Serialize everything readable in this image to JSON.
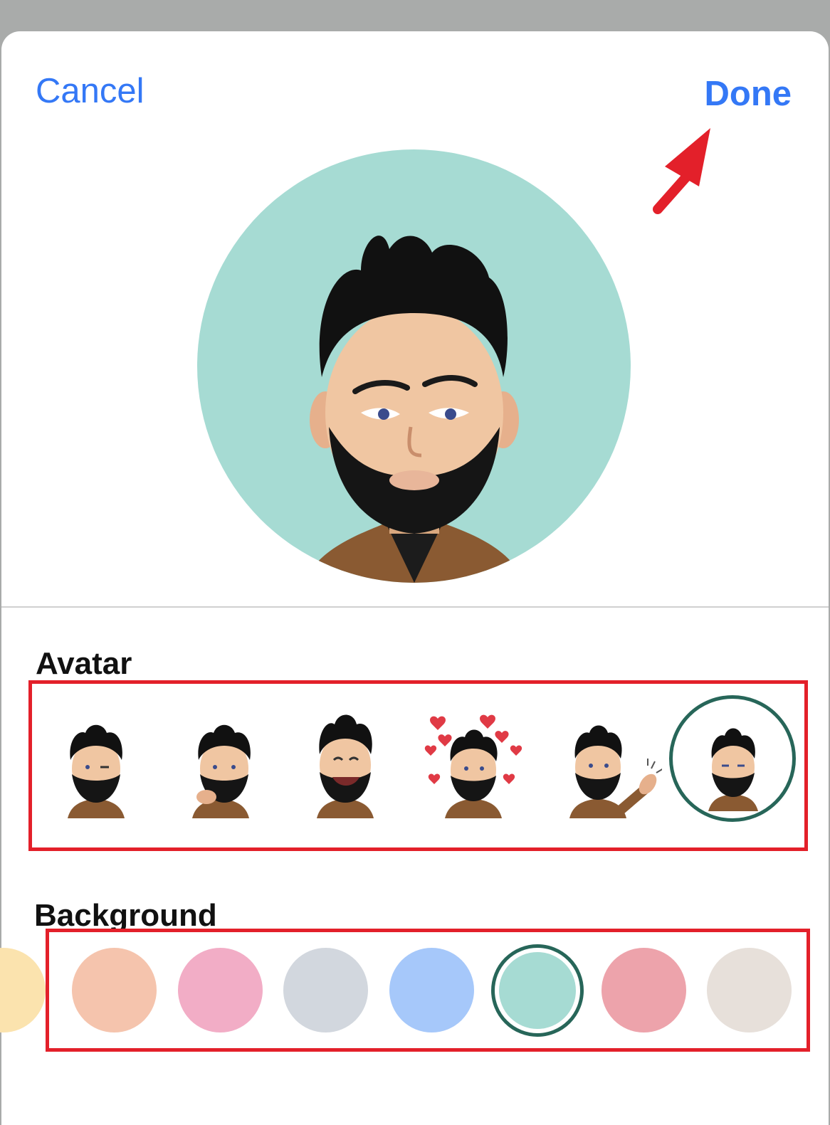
{
  "header": {
    "cancel_label": "Cancel",
    "done_label": "Done"
  },
  "preview": {
    "background_color": "#a6dbd3",
    "avatar_icon": "memoji-avatar-icon"
  },
  "sections": {
    "avatar_title": "Avatar",
    "background_title": "Background"
  },
  "avatars": [
    {
      "name": "memoji-wink-icon",
      "selected": false
    },
    {
      "name": "memoji-thinking-icon",
      "selected": false
    },
    {
      "name": "memoji-laughing-icon",
      "selected": false
    },
    {
      "name": "memoji-hearts-icon",
      "selected": false
    },
    {
      "name": "memoji-clapping-icon",
      "selected": false
    },
    {
      "name": "memoji-neutral-icon",
      "selected": true
    }
  ],
  "backgrounds": [
    {
      "color": "#fbe3ae",
      "selected": false
    },
    {
      "color": "#f5c4ad",
      "selected": false
    },
    {
      "color": "#f2adc6",
      "selected": false
    },
    {
      "color": "#d2d7de",
      "selected": false
    },
    {
      "color": "#a6c8fa",
      "selected": false
    },
    {
      "color": "#a6dbd3",
      "selected": true
    },
    {
      "color": "#eda3ab",
      "selected": false
    },
    {
      "color": "#e7e0da",
      "selected": false
    }
  ],
  "colors": {
    "accent": "#3478f6",
    "highlight": "#e3202a",
    "selection_ring": "#276659"
  }
}
